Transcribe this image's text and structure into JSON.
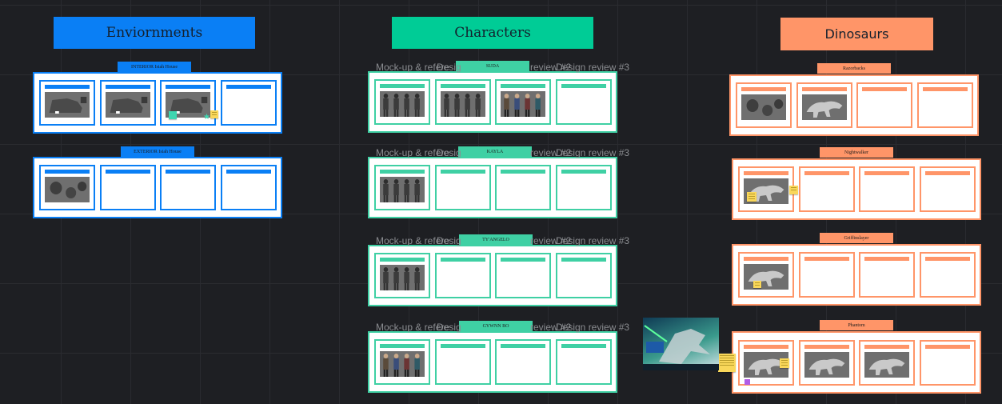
{
  "colors": {
    "blue": "#0a7ff5",
    "green": "#00cc96",
    "orange": "#ff9568",
    "canvas": "#1e1f23"
  },
  "environments": {
    "title": "Enviornments",
    "frames": [
      "INTERIOR Isiah House",
      "EXTERIOR Isiah House"
    ]
  },
  "characters": {
    "title": "Characters",
    "frames": [
      "SUDA",
      "KAYLA",
      "TY'ANGELO",
      "GYWNN BO"
    ],
    "review_labels": [
      "Mock-up & refere",
      "Desig",
      "review #2",
      "Design review #3"
    ]
  },
  "dinosaurs": {
    "title": "Dinosaurs",
    "frames": [
      "Razorbacks",
      "Nightwalker",
      "Griffinslayer",
      "Phantom"
    ]
  },
  "book_cover": {
    "icon": "dinosaur-book-cover-image"
  }
}
